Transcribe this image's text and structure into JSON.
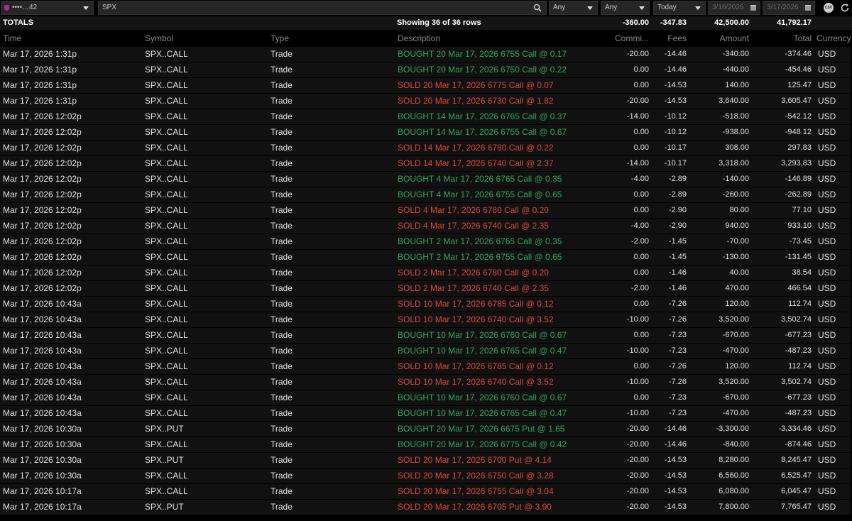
{
  "filters": {
    "account": "••••…42",
    "search_value": "SPX",
    "type_filter": "Any",
    "status_filter": "Any",
    "date_range": "Today",
    "date_from": "3/16/2026",
    "date_to": "3/17/2026",
    "csv_label": "CSV"
  },
  "totals": {
    "label": "TOTALS",
    "summary": "Showing 36 of 36 rows",
    "commission": "-360.00",
    "fees": "-347.83",
    "amount": "42,500.00",
    "total": "41,792.17"
  },
  "columns": {
    "time": "Time",
    "symbol": "Symbol",
    "type": "Type",
    "description": "Description",
    "commission": "Commi...",
    "fees": "Fees",
    "amount": "Amount",
    "total": "Total",
    "currency": "Currency"
  },
  "colors": {
    "buy": "#2fa45a",
    "sell": "#e0453d"
  },
  "rows": [
    {
      "time": "Mar 17, 2026  1:31p",
      "symbol": "SPX..CALL",
      "type": "Trade",
      "side": "buy",
      "description": "BOUGHT 20 Mar 17, 2026 6755 Call @ 0.17",
      "commission": "-20.00",
      "fees": "-14.46",
      "amount": "-340.00",
      "total": "-374.46",
      "currency": "USD"
    },
    {
      "time": "Mar 17, 2026  1:31p",
      "symbol": "SPX..CALL",
      "type": "Trade",
      "side": "buy",
      "description": "BOUGHT 20 Mar 17, 2026 6750 Call @ 0.22",
      "commission": "0.00",
      "fees": "-14.46",
      "amount": "-440.00",
      "total": "-454.46",
      "currency": "USD"
    },
    {
      "time": "Mar 17, 2026  1:31p",
      "symbol": "SPX..CALL",
      "type": "Trade",
      "side": "sell",
      "description": "SOLD 20 Mar 17, 2026 6775 Call @ 0.07",
      "commission": "0.00",
      "fees": "-14.53",
      "amount": "140.00",
      "total": "125.47",
      "currency": "USD"
    },
    {
      "time": "Mar 17, 2026  1:31p",
      "symbol": "SPX..CALL",
      "type": "Trade",
      "side": "sell",
      "description": "SOLD 20 Mar 17, 2026 6730 Call @ 1.82",
      "commission": "-20.00",
      "fees": "-14.53",
      "amount": "3,640.00",
      "total": "3,605.47",
      "currency": "USD"
    },
    {
      "time": "Mar 17, 2026  12:02p",
      "symbol": "SPX..CALL",
      "type": "Trade",
      "side": "buy",
      "description": "BOUGHT 14 Mar 17, 2026 6765 Call @ 0.37",
      "commission": "-14.00",
      "fees": "-10.12",
      "amount": "-518.00",
      "total": "-542.12",
      "currency": "USD"
    },
    {
      "time": "Mar 17, 2026  12:02p",
      "symbol": "SPX..CALL",
      "type": "Trade",
      "side": "buy",
      "description": "BOUGHT 14 Mar 17, 2026 6755 Call @ 0.67",
      "commission": "0.00",
      "fees": "-10.12",
      "amount": "-938.00",
      "total": "-948.12",
      "currency": "USD"
    },
    {
      "time": "Mar 17, 2026  12:02p",
      "symbol": "SPX..CALL",
      "type": "Trade",
      "side": "sell",
      "description": "SOLD 14 Mar 17, 2026 6780 Call @ 0.22",
      "commission": "0.00",
      "fees": "-10.17",
      "amount": "308.00",
      "total": "297.83",
      "currency": "USD"
    },
    {
      "time": "Mar 17, 2026  12:02p",
      "symbol": "SPX..CALL",
      "type": "Trade",
      "side": "sell",
      "description": "SOLD 14 Mar 17, 2026 6740 Call @ 2.37",
      "commission": "-14.00",
      "fees": "-10.17",
      "amount": "3,318.00",
      "total": "3,293.83",
      "currency": "USD"
    },
    {
      "time": "Mar 17, 2026  12:02p",
      "symbol": "SPX..CALL",
      "type": "Trade",
      "side": "buy",
      "description": "BOUGHT 4 Mar 17, 2026 6765 Call @ 0.35",
      "commission": "-4.00",
      "fees": "-2.89",
      "amount": "-140.00",
      "total": "-146.89",
      "currency": "USD"
    },
    {
      "time": "Mar 17, 2026  12:02p",
      "symbol": "SPX..CALL",
      "type": "Trade",
      "side": "buy",
      "description": "BOUGHT 4 Mar 17, 2026 6755 Call @ 0.65",
      "commission": "0.00",
      "fees": "-2.89",
      "amount": "-260.00",
      "total": "-262.89",
      "currency": "USD"
    },
    {
      "time": "Mar 17, 2026  12:02p",
      "symbol": "SPX..CALL",
      "type": "Trade",
      "side": "sell",
      "description": "SOLD 4 Mar 17, 2026 6780 Call @ 0.20",
      "commission": "0.00",
      "fees": "-2.90",
      "amount": "80.00",
      "total": "77.10",
      "currency": "USD"
    },
    {
      "time": "Mar 17, 2026  12:02p",
      "symbol": "SPX..CALL",
      "type": "Trade",
      "side": "sell",
      "description": "SOLD 4 Mar 17, 2026 6740 Call @ 2.35",
      "commission": "-4.00",
      "fees": "-2.90",
      "amount": "940.00",
      "total": "933.10",
      "currency": "USD"
    },
    {
      "time": "Mar 17, 2026  12:02p",
      "symbol": "SPX..CALL",
      "type": "Trade",
      "side": "buy",
      "description": "BOUGHT 2 Mar 17, 2026 6765 Call @ 0.35",
      "commission": "-2.00",
      "fees": "-1.45",
      "amount": "-70.00",
      "total": "-73.45",
      "currency": "USD"
    },
    {
      "time": "Mar 17, 2026  12:02p",
      "symbol": "SPX..CALL",
      "type": "Trade",
      "side": "buy",
      "description": "BOUGHT 2 Mar 17, 2026 6755 Call @ 0.65",
      "commission": "0.00",
      "fees": "-1.45",
      "amount": "-130.00",
      "total": "-131.45",
      "currency": "USD"
    },
    {
      "time": "Mar 17, 2026  12:02p",
      "symbol": "SPX..CALL",
      "type": "Trade",
      "side": "sell",
      "description": "SOLD 2 Mar 17, 2026 6780 Call @ 0.20",
      "commission": "0.00",
      "fees": "-1.46",
      "amount": "40.00",
      "total": "38.54",
      "currency": "USD"
    },
    {
      "time": "Mar 17, 2026  12:02p",
      "symbol": "SPX..CALL",
      "type": "Trade",
      "side": "sell",
      "description": "SOLD 2 Mar 17, 2026 6740 Call @ 2.35",
      "commission": "-2.00",
      "fees": "-1.46",
      "amount": "470.00",
      "total": "466.54",
      "currency": "USD"
    },
    {
      "time": "Mar 17, 2026  10:43a",
      "symbol": "SPX..CALL",
      "type": "Trade",
      "side": "sell",
      "description": "SOLD 10 Mar 17, 2026 6785 Call @ 0.12",
      "commission": "0.00",
      "fees": "-7.26",
      "amount": "120.00",
      "total": "112.74",
      "currency": "USD"
    },
    {
      "time": "Mar 17, 2026  10:43a",
      "symbol": "SPX..CALL",
      "type": "Trade",
      "side": "sell",
      "description": "SOLD 10 Mar 17, 2026 6740 Call @ 3.52",
      "commission": "-10.00",
      "fees": "-7.26",
      "amount": "3,520.00",
      "total": "3,502.74",
      "currency": "USD"
    },
    {
      "time": "Mar 17, 2026  10:43a",
      "symbol": "SPX..CALL",
      "type": "Trade",
      "side": "buy",
      "description": "BOUGHT 10 Mar 17, 2026 6760 Call @ 0.67",
      "commission": "0.00",
      "fees": "-7.23",
      "amount": "-670.00",
      "total": "-677.23",
      "currency": "USD"
    },
    {
      "time": "Mar 17, 2026  10:43a",
      "symbol": "SPX..CALL",
      "type": "Trade",
      "side": "buy",
      "description": "BOUGHT 10 Mar 17, 2026 6765 Call @ 0.47",
      "commission": "-10.00",
      "fees": "-7.23",
      "amount": "-470.00",
      "total": "-487.23",
      "currency": "USD"
    },
    {
      "time": "Mar 17, 2026  10:43a",
      "symbol": "SPX..CALL",
      "type": "Trade",
      "side": "sell",
      "description": "SOLD 10 Mar 17, 2026 6785 Call @ 0.12",
      "commission": "0.00",
      "fees": "-7.26",
      "amount": "120.00",
      "total": "112.74",
      "currency": "USD"
    },
    {
      "time": "Mar 17, 2026  10:43a",
      "symbol": "SPX..CALL",
      "type": "Trade",
      "side": "sell",
      "description": "SOLD 10 Mar 17, 2026 6740 Call @ 3.52",
      "commission": "-10.00",
      "fees": "-7.26",
      "amount": "3,520.00",
      "total": "3,502.74",
      "currency": "USD"
    },
    {
      "time": "Mar 17, 2026  10:43a",
      "symbol": "SPX..CALL",
      "type": "Trade",
      "side": "buy",
      "description": "BOUGHT 10 Mar 17, 2026 6760 Call @ 0.67",
      "commission": "0.00",
      "fees": "-7.23",
      "amount": "-670.00",
      "total": "-677.23",
      "currency": "USD"
    },
    {
      "time": "Mar 17, 2026  10:43a",
      "symbol": "SPX..CALL",
      "type": "Trade",
      "side": "buy",
      "description": "BOUGHT 10 Mar 17, 2026 6765 Call @ 0.47",
      "commission": "-10.00",
      "fees": "-7.23",
      "amount": "-470.00",
      "total": "-487.23",
      "currency": "USD"
    },
    {
      "time": "Mar 17, 2026  10:30a",
      "symbol": "SPX..PUT",
      "type": "Trade",
      "side": "buy",
      "description": "BOUGHT 20 Mar 17, 2026 6675 Put @ 1.65",
      "commission": "-20.00",
      "fees": "-14.46",
      "amount": "-3,300.00",
      "total": "-3,334.46",
      "currency": "USD"
    },
    {
      "time": "Mar 17, 2026  10:30a",
      "symbol": "SPX..CALL",
      "type": "Trade",
      "side": "buy",
      "description": "BOUGHT 20 Mar 17, 2026 6775 Call @ 0.42",
      "commission": "-20.00",
      "fees": "-14.46",
      "amount": "-840.00",
      "total": "-874.46",
      "currency": "USD"
    },
    {
      "time": "Mar 17, 2026  10:30a",
      "symbol": "SPX..PUT",
      "type": "Trade",
      "side": "sell",
      "description": "SOLD 20 Mar 17, 2026 6700 Put @ 4.14",
      "commission": "-20.00",
      "fees": "-14.53",
      "amount": "8,280.00",
      "total": "8,245.47",
      "currency": "USD"
    },
    {
      "time": "Mar 17, 2026  10:30a",
      "symbol": "SPX..CALL",
      "type": "Trade",
      "side": "sell",
      "description": "SOLD 20 Mar 17, 2026 6750 Call @ 3.28",
      "commission": "-20.00",
      "fees": "-14.53",
      "amount": "6,560.00",
      "total": "6,525.47",
      "currency": "USD"
    },
    {
      "time": "Mar 17, 2026  10:17a",
      "symbol": "SPX..CALL",
      "type": "Trade",
      "side": "sell",
      "description": "SOLD 20 Mar 17, 2026 6755 Call @ 3.04",
      "commission": "-20.00",
      "fees": "-14.53",
      "amount": "6,080.00",
      "total": "6,045.47",
      "currency": "USD"
    },
    {
      "time": "Mar 17, 2026  10:17a",
      "symbol": "SPX..PUT",
      "type": "Trade",
      "side": "sell",
      "description": "SOLD 20 Mar 17, 2026 6705 Put @ 3.90",
      "commission": "-20.00",
      "fees": "-14.53",
      "amount": "7,800.00",
      "total": "7,765.47",
      "currency": "USD"
    }
  ]
}
